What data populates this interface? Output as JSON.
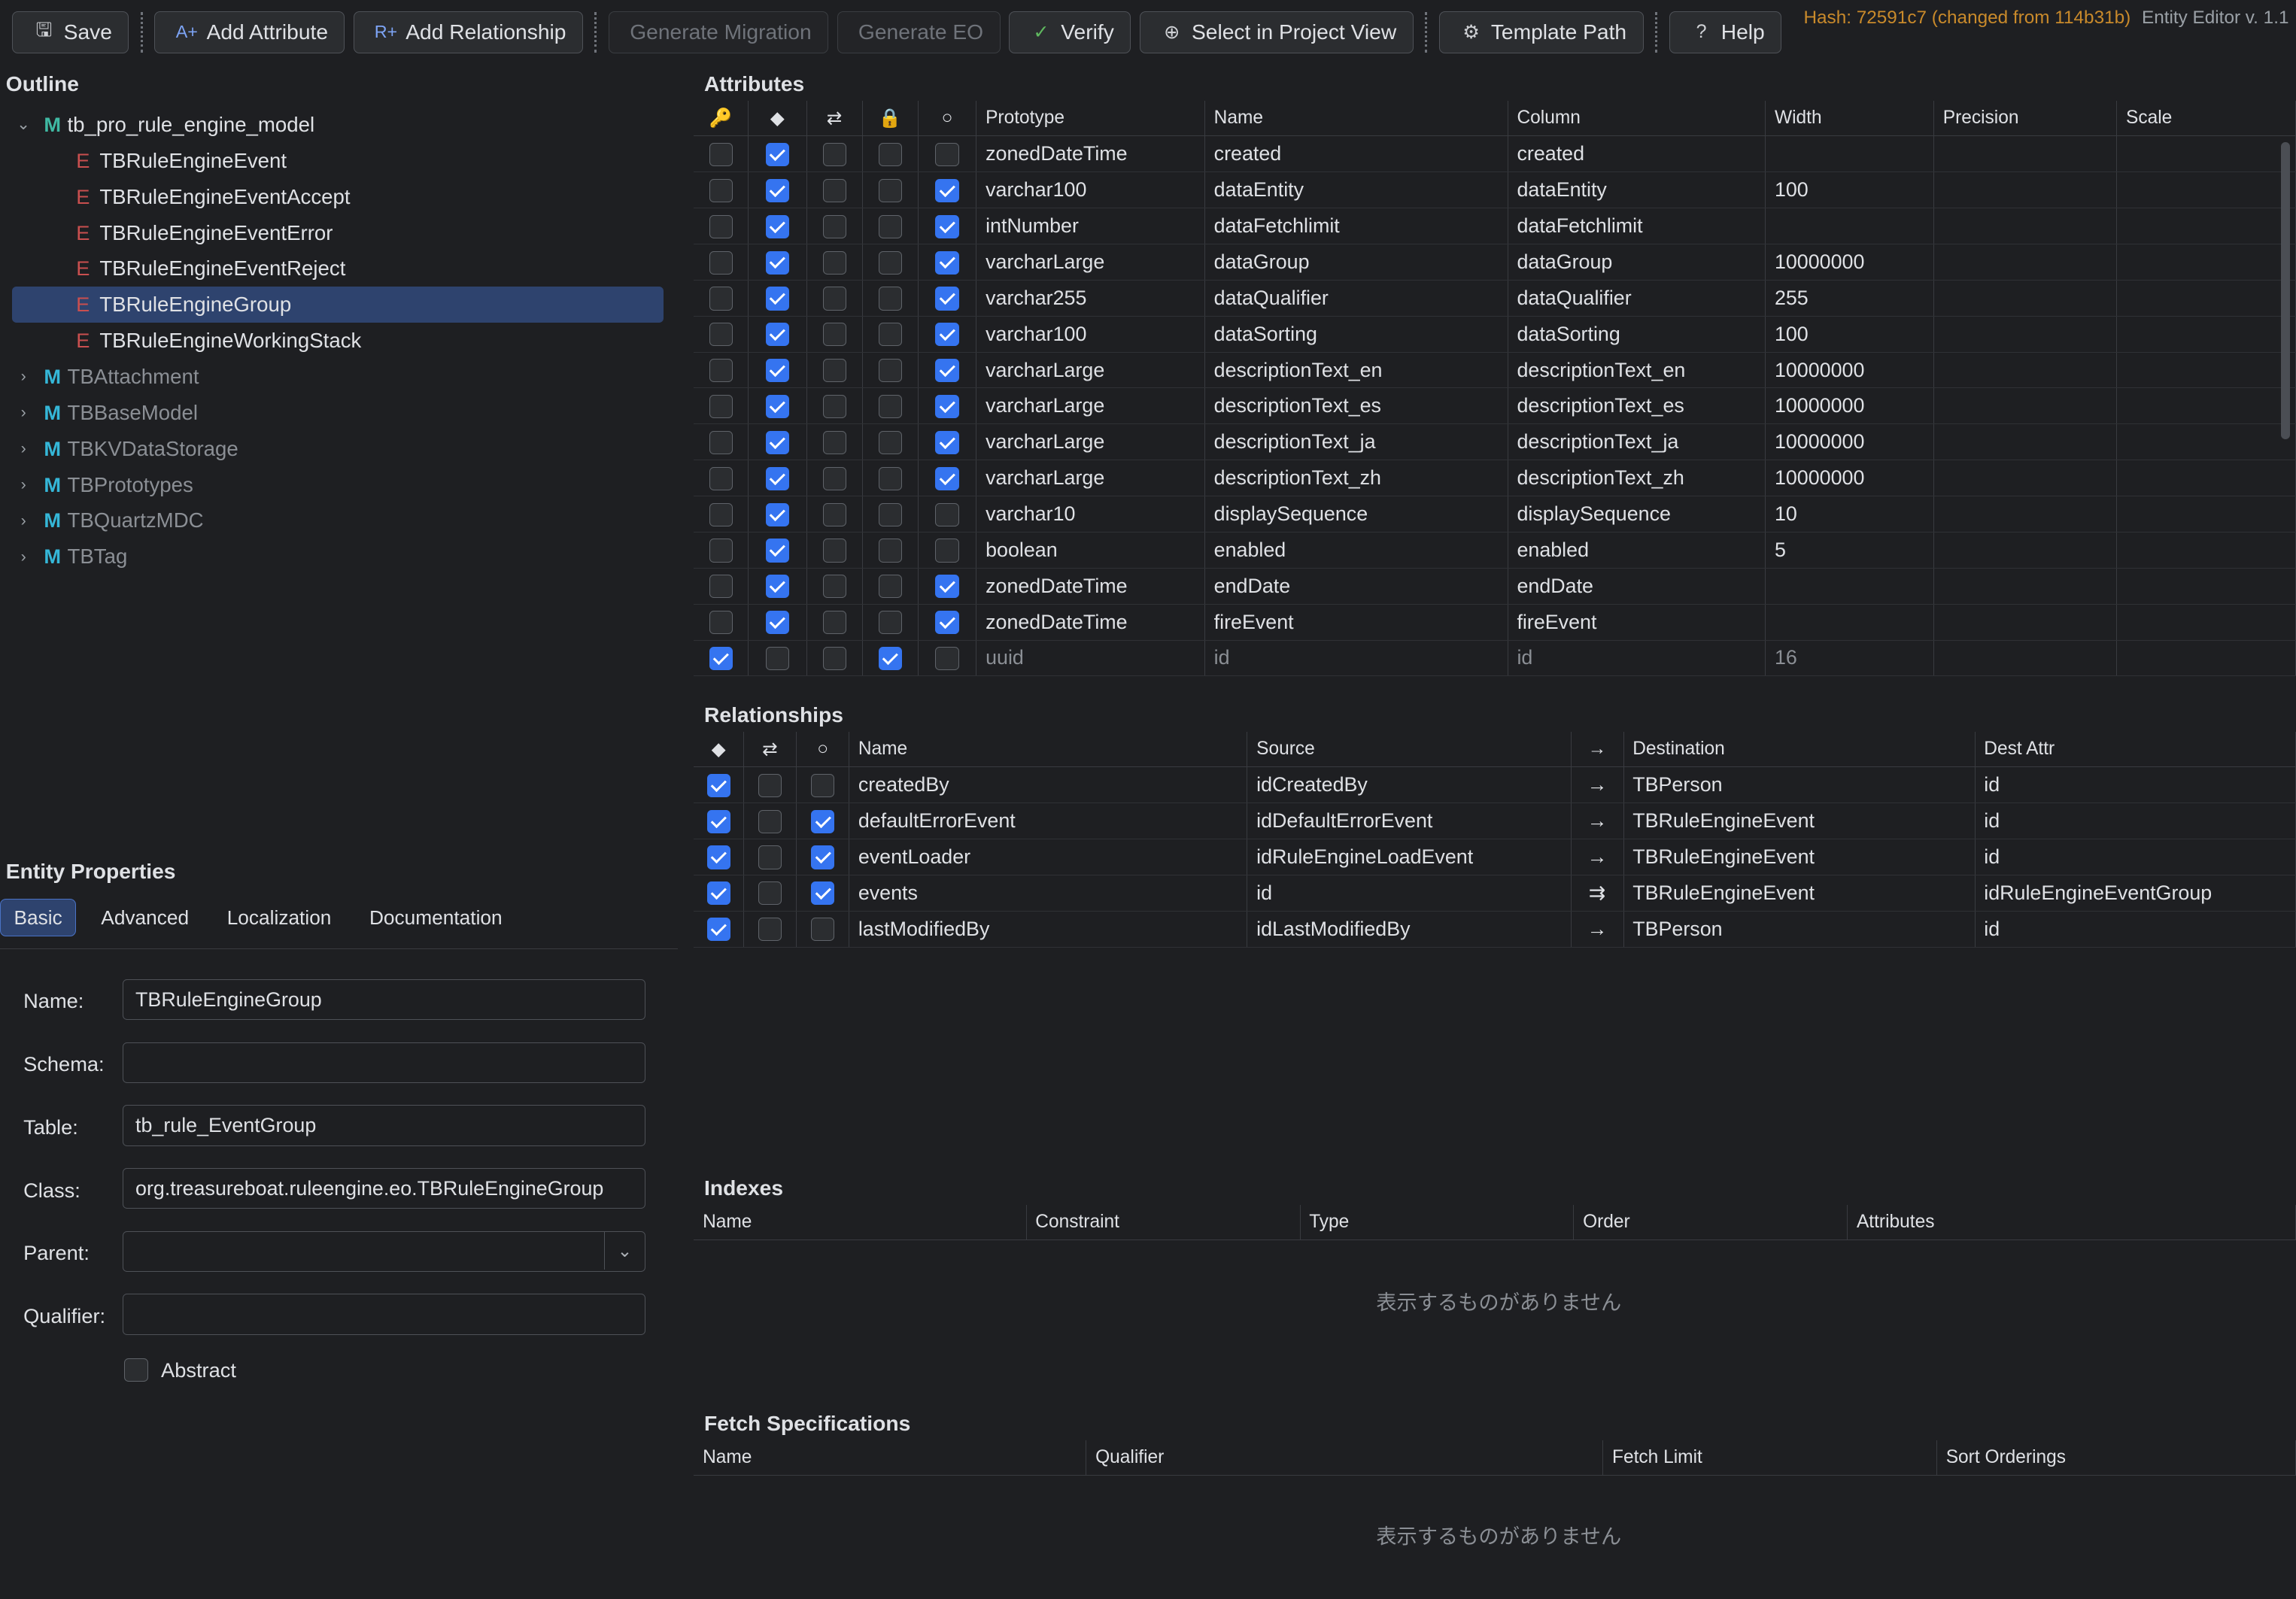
{
  "toolbar": {
    "save": "Save",
    "add_attribute": "Add Attribute",
    "add_relationship": "Add Relationship",
    "generate_migration": "Generate Migration",
    "generate_eo": "Generate EO",
    "verify": "Verify",
    "select_project": "Select in Project View",
    "template_path": "Template Path",
    "help": "Help"
  },
  "status": {
    "hash": "Hash: 72591c7 (changed from 114b31b)",
    "version": "Entity Editor v. 1.1"
  },
  "outline": {
    "title": "Outline",
    "root": {
      "glyph": "M",
      "label": "tb_pro_rule_engine_model"
    },
    "entities": [
      {
        "glyph": "E",
        "label": "TBRuleEngineEvent"
      },
      {
        "glyph": "E",
        "label": "TBRuleEngineEventAccept"
      },
      {
        "glyph": "E",
        "label": "TBRuleEngineEventError"
      },
      {
        "glyph": "E",
        "label": "TBRuleEngineEventReject"
      },
      {
        "glyph": "E",
        "label": "TBRuleEngineGroup"
      },
      {
        "glyph": "E",
        "label": "TBRuleEngineWorkingStack"
      }
    ],
    "models": [
      {
        "glyph": "M",
        "label": "TBAttachment"
      },
      {
        "glyph": "M",
        "label": "TBBaseModel"
      },
      {
        "glyph": "M",
        "label": "TBKVDataStorage"
      },
      {
        "glyph": "M",
        "label": "TBPrototypes"
      },
      {
        "glyph": "M",
        "label": "TBQuartzMDC"
      },
      {
        "glyph": "M",
        "label": "TBTag"
      }
    ]
  },
  "entity_properties": {
    "title": "Entity Properties",
    "tabs": [
      "Basic",
      "Advanced",
      "Localization",
      "Documentation"
    ],
    "fields": {
      "name_label": "Name:",
      "name_value": "TBRuleEngineGroup",
      "schema_label": "Schema:",
      "schema_value": "",
      "table_label": "Table:",
      "table_value": "tb_rule_EventGroup",
      "class_label": "Class:",
      "class_value": "org.treasureboat.ruleengine.eo.TBRuleEngineGroup",
      "parent_label": "Parent:",
      "parent_value": "",
      "qualifier_label": "Qualifier:",
      "qualifier_value": "",
      "abstract_label": "Abstract"
    }
  },
  "attributes": {
    "title": "Attributes",
    "headers": [
      "Prototype",
      "Name",
      "Column",
      "Width",
      "Precision",
      "Scale"
    ],
    "rows": [
      {
        "pk": false,
        "attr": true,
        "lock": false,
        "cls": false,
        "opt": false,
        "prototype": "zonedDateTime",
        "name": "created",
        "column": "created",
        "width": ""
      },
      {
        "pk": false,
        "attr": true,
        "lock": false,
        "cls": false,
        "opt": true,
        "prototype": "varchar100",
        "name": "dataEntity",
        "column": "dataEntity",
        "width": "100"
      },
      {
        "pk": false,
        "attr": true,
        "lock": false,
        "cls": false,
        "opt": true,
        "prototype": "intNumber",
        "name": "dataFetchlimit",
        "column": "dataFetchlimit",
        "width": ""
      },
      {
        "pk": false,
        "attr": true,
        "lock": false,
        "cls": false,
        "opt": true,
        "prototype": "varcharLarge",
        "name": "dataGroup",
        "column": "dataGroup",
        "width": "10000000"
      },
      {
        "pk": false,
        "attr": true,
        "lock": false,
        "cls": false,
        "opt": true,
        "prototype": "varchar255",
        "name": "dataQualifier",
        "column": "dataQualifier",
        "width": "255"
      },
      {
        "pk": false,
        "attr": true,
        "lock": false,
        "cls": false,
        "opt": true,
        "prototype": "varchar100",
        "name": "dataSorting",
        "column": "dataSorting",
        "width": "100"
      },
      {
        "pk": false,
        "attr": true,
        "lock": false,
        "cls": false,
        "opt": true,
        "prototype": "varcharLarge",
        "name": "descriptionText_en",
        "column": "descriptionText_en",
        "width": "10000000"
      },
      {
        "pk": false,
        "attr": true,
        "lock": false,
        "cls": false,
        "opt": true,
        "prototype": "varcharLarge",
        "name": "descriptionText_es",
        "column": "descriptionText_es",
        "width": "10000000"
      },
      {
        "pk": false,
        "attr": true,
        "lock": false,
        "cls": false,
        "opt": true,
        "prototype": "varcharLarge",
        "name": "descriptionText_ja",
        "column": "descriptionText_ja",
        "width": "10000000"
      },
      {
        "pk": false,
        "attr": true,
        "lock": false,
        "cls": false,
        "opt": true,
        "prototype": "varcharLarge",
        "name": "descriptionText_zh",
        "column": "descriptionText_zh",
        "width": "10000000"
      },
      {
        "pk": false,
        "attr": true,
        "lock": false,
        "cls": false,
        "opt": false,
        "prototype": "varchar10",
        "name": "displaySequence",
        "column": "displaySequence",
        "width": "10"
      },
      {
        "pk": false,
        "attr": true,
        "lock": false,
        "cls": false,
        "opt": false,
        "prototype": "boolean",
        "name": "enabled",
        "column": "enabled",
        "width": "5"
      },
      {
        "pk": false,
        "attr": true,
        "lock": false,
        "cls": false,
        "opt": true,
        "prototype": "zonedDateTime",
        "name": "endDate",
        "column": "endDate",
        "width": ""
      },
      {
        "pk": false,
        "attr": true,
        "lock": false,
        "cls": false,
        "opt": true,
        "prototype": "zonedDateTime",
        "name": "fireEvent",
        "column": "fireEvent",
        "width": ""
      },
      {
        "pk": true,
        "attr": false,
        "lock": false,
        "cls": true,
        "opt": false,
        "prototype": "uuid",
        "name": "id",
        "column": "id",
        "width": "16",
        "dim": true
      }
    ]
  },
  "relationships": {
    "title": "Relationships",
    "headers": [
      "Name",
      "Source",
      "Destination",
      "Dest Attr"
    ],
    "rows": [
      {
        "c1": true,
        "c2": false,
        "c3": false,
        "name": "createdBy",
        "source": "idCreatedBy",
        "arrow": "→",
        "dest": "TBPerson",
        "dest_attr": "id"
      },
      {
        "c1": true,
        "c2": false,
        "c3": true,
        "name": "defaultErrorEvent",
        "source": "idDefaultErrorEvent",
        "arrow": "→",
        "dest": "TBRuleEngineEvent",
        "dest_attr": "id"
      },
      {
        "c1": true,
        "c2": false,
        "c3": true,
        "name": "eventLoader",
        "source": "idRuleEngineLoadEvent",
        "arrow": "→",
        "dest": "TBRuleEngineEvent",
        "dest_attr": "id"
      },
      {
        "c1": true,
        "c2": false,
        "c3": true,
        "name": "events",
        "source": "id",
        "arrow": "⇉",
        "dest": "TBRuleEngineEvent",
        "dest_attr": "idRuleEngineEventGroup"
      },
      {
        "c1": true,
        "c2": false,
        "c3": false,
        "name": "lastModifiedBy",
        "source": "idLastModifiedBy",
        "arrow": "→",
        "dest": "TBPerson",
        "dest_attr": "id"
      }
    ]
  },
  "indexes": {
    "title": "Indexes",
    "headers": [
      "Name",
      "Constraint",
      "Type",
      "Order",
      "Attributes"
    ],
    "empty": "表示するものがありません"
  },
  "fetch_specs": {
    "title": "Fetch Specifications",
    "headers": [
      "Name",
      "Qualifier",
      "Fetch Limit",
      "Sort Orderings"
    ],
    "empty": "表示するものがありません"
  },
  "colors": {
    "accent": "#3574f0",
    "selection": "#2e436e",
    "hash": "#c98a2b",
    "model_icon": "#35b7d8",
    "entity_icon": "#c94f4f"
  }
}
